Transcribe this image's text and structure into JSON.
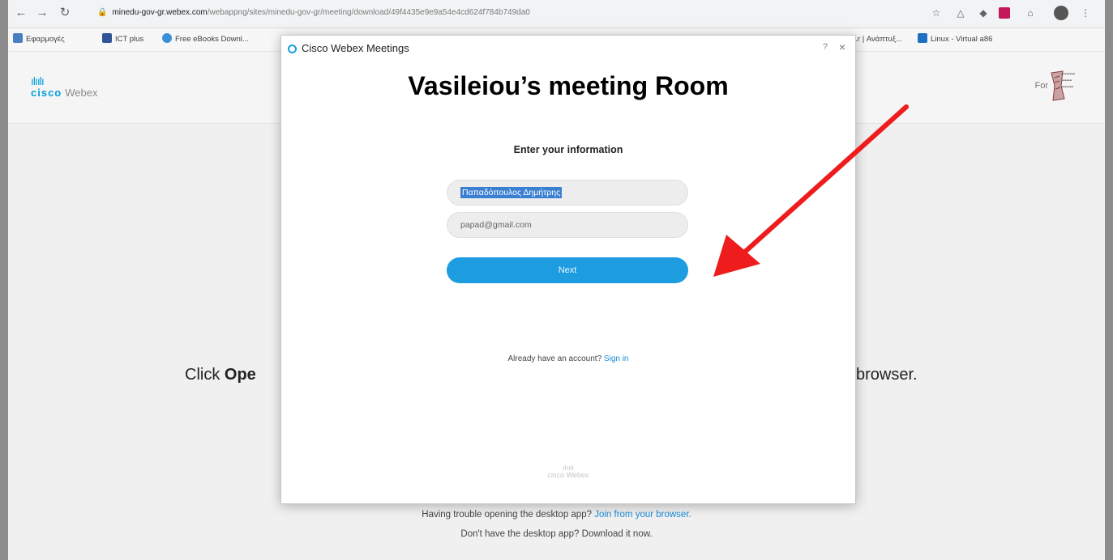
{
  "browser": {
    "url_host": "minedu-gov-gr.webex.com",
    "url_path": "/webappng/sites/minedu-gov-gr/meeting/download/49f4435e9e9a54e4cd624f784b749da0",
    "bookmarks": [
      "Εφαρμογές",
      "ICT plus",
      "Free eBooks Downl...",
      "...r | Ανάπτυξ...",
      "Linux - Virtual a86"
    ]
  },
  "header": {
    "cisco_word": "cisco",
    "webex_word": "Webex",
    "for_label": "For"
  },
  "background": {
    "click_text_part1": "Click ",
    "click_text_bold": "Ope",
    "browser_text": "browser.",
    "trouble_text": "Having trouble opening the desktop app? ",
    "trouble_link": "Join from your browser.",
    "download_text": "Don't have the desktop app? Download it now."
  },
  "dialog": {
    "title": "Cisco Webex Meetings",
    "overlay_label": "Vasileiou’s meeting Room",
    "heading": "Enter your information",
    "name_value": "Παπαδόπουλος Δημήτρης",
    "email_value": "papad@gmail.com",
    "next_label": "Next",
    "already_text": "Already have an account? ",
    "signin_link": "Sign in",
    "footer_cisco": "cisco",
    "footer_webex": "Webex"
  },
  "annotation": {
    "arrow_color": "#ee1c1c"
  },
  "colors": {
    "accent": "#1d9ce0",
    "link": "#1b8ad6"
  }
}
